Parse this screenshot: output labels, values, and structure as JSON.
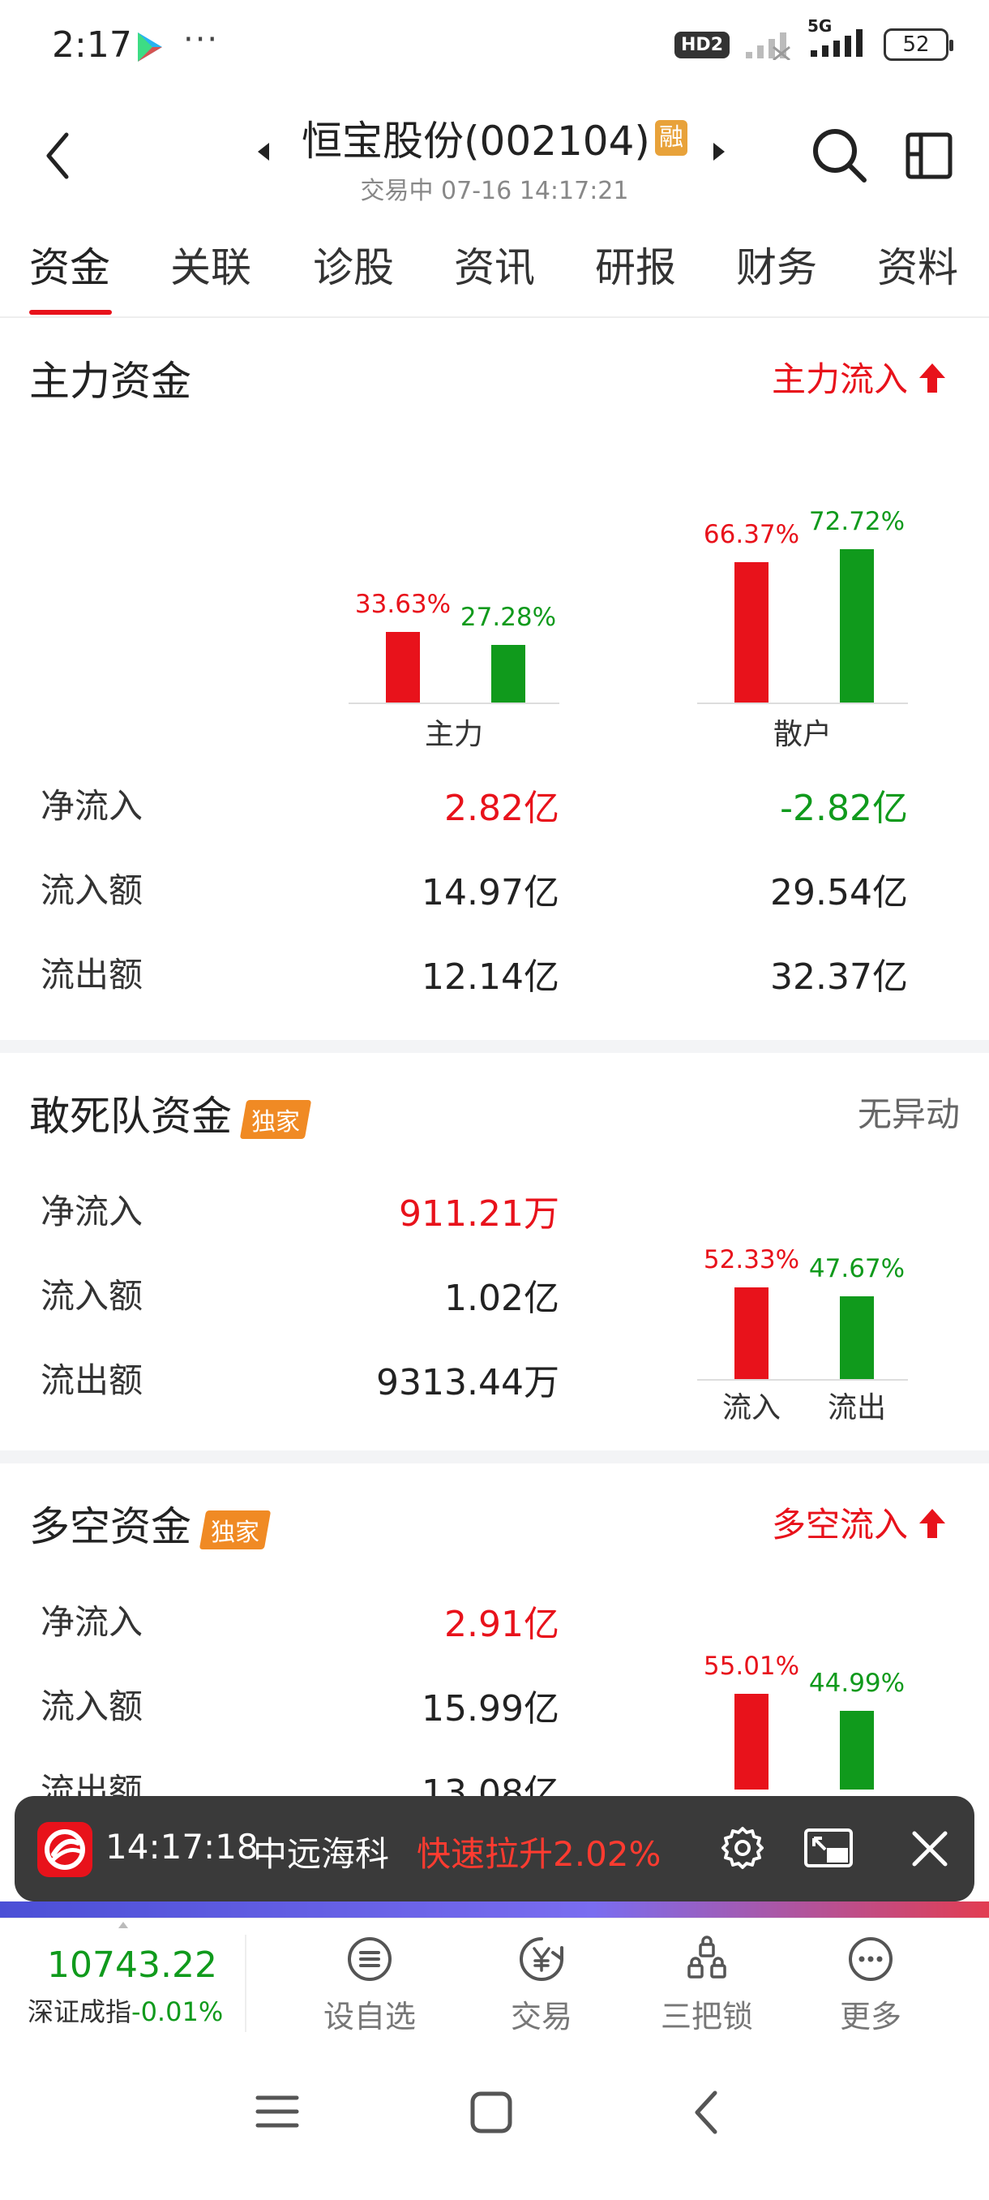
{
  "status_bar": {
    "time": "2:17",
    "more": "···",
    "hd_badge": "HD2",
    "network": "5G",
    "battery": "52"
  },
  "header": {
    "title": "恒宝股份(002104)",
    "margin_badge": "融",
    "subtitle": "交易中 07-16 14:17:21"
  },
  "tabs": [
    {
      "label": "资金",
      "active": true
    },
    {
      "label": "关联",
      "active": false
    },
    {
      "label": "诊股",
      "active": false
    },
    {
      "label": "资讯",
      "active": false
    },
    {
      "label": "研报",
      "active": false
    },
    {
      "label": "财务",
      "active": false
    },
    {
      "label": "资料",
      "active": false
    }
  ],
  "main_fund": {
    "title": "主力资金",
    "status": "主力流入",
    "chart": {
      "groups": [
        {
          "name": "主力",
          "inflow_pct": "33.63%",
          "outflow_pct": "27.28%",
          "inflow": 33.63,
          "outflow": 27.28
        },
        {
          "name": "散户",
          "inflow_pct": "66.37%",
          "outflow_pct": "72.72%",
          "inflow": 66.37,
          "outflow": 72.72
        }
      ]
    },
    "rows": [
      {
        "label": "净流入",
        "main": "2.82亿",
        "retail": "-2.82亿"
      },
      {
        "label": "流入额",
        "main": "14.97亿",
        "retail": "29.54亿"
      },
      {
        "label": "流出额",
        "main": "12.14亿",
        "retail": "32.37亿"
      }
    ]
  },
  "dare_fund": {
    "title": "敢死队资金",
    "tag": "独家",
    "status": "无异动",
    "rows": [
      {
        "label": "净流入",
        "value": "911.21万"
      },
      {
        "label": "流入额",
        "value": "1.02亿"
      },
      {
        "label": "流出额",
        "value": "9313.44万"
      }
    ],
    "chart": {
      "inflow_pct": "52.33%",
      "outflow_pct": "47.67%",
      "inflow": 52.33,
      "outflow": 47.67,
      "inflow_label": "流入",
      "outflow_label": "流出"
    }
  },
  "long_short_fund": {
    "title": "多空资金",
    "tag": "独家",
    "status": "多空流入",
    "rows": [
      {
        "label": "净流入",
        "value": "2.91亿"
      },
      {
        "label": "流入额",
        "value": "15.99亿"
      },
      {
        "label": "流出额",
        "value": "13.08亿"
      }
    ],
    "chart": {
      "inflow_pct": "55.01%",
      "outflow_pct": "44.99%",
      "inflow": 55.01,
      "outflow": 44.99
    }
  },
  "notification": {
    "time": "14:17:18",
    "stock": "中远海科",
    "event": "快速拉升2.02%"
  },
  "bottom_bar": {
    "index_value": "10743.22",
    "index_name": "深证成指",
    "index_change": "-0.01%",
    "items": [
      {
        "label": "设自选",
        "icon": "list-icon"
      },
      {
        "label": "交易",
        "icon": "yuan-icon"
      },
      {
        "label": "三把锁",
        "icon": "lock-group-icon"
      },
      {
        "label": "更多",
        "icon": "more-icon"
      }
    ]
  },
  "colors": {
    "red": "#e8121b",
    "green": "#109a1c",
    "tag_orange": "#f08a24",
    "margin_badge": "#e8a23a"
  }
}
